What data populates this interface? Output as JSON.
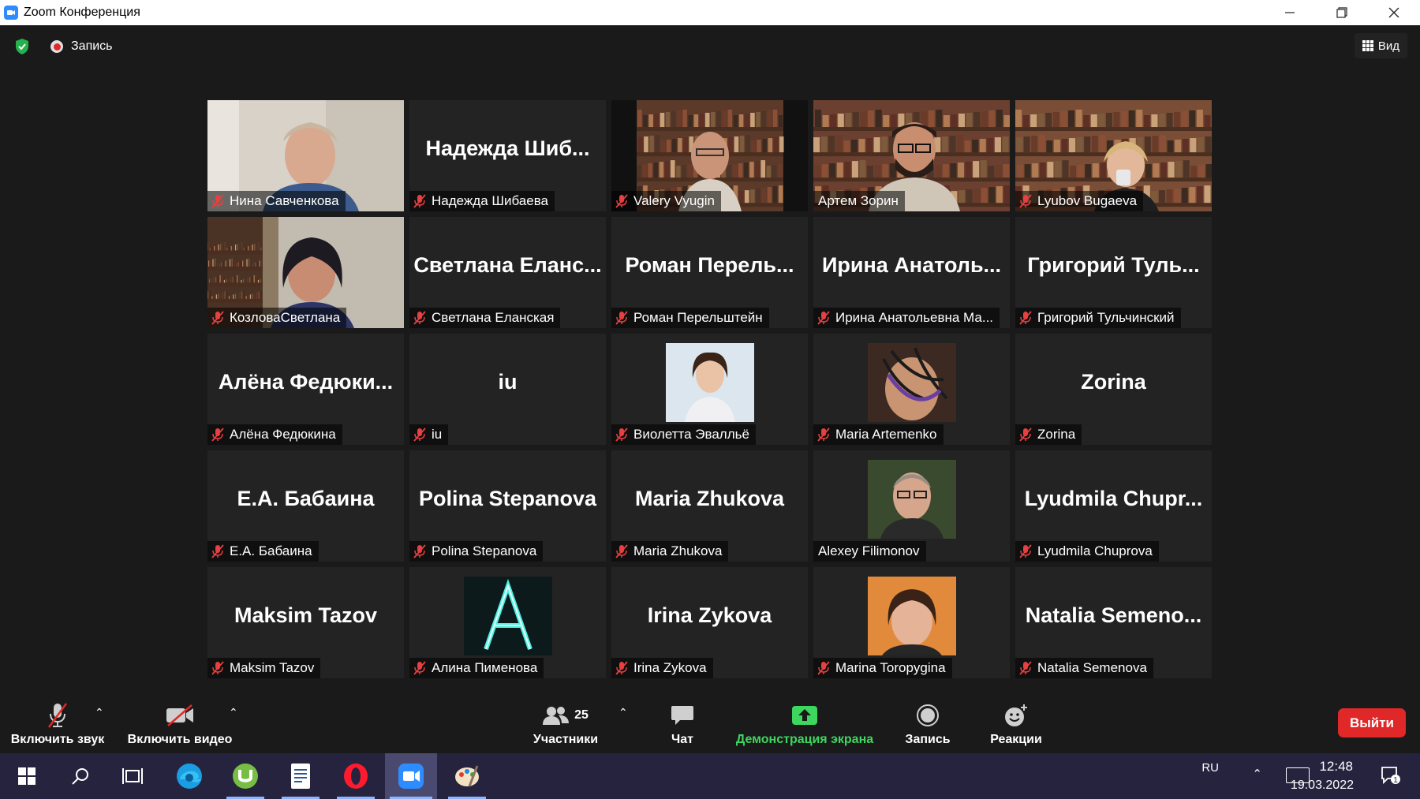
{
  "window": {
    "title": "Zoom Конференция"
  },
  "topbar": {
    "recording_label": "Запись",
    "view_label": "Вид"
  },
  "participants": [
    {
      "label": "Нина Савченкова",
      "big": "",
      "muted": true,
      "video": "nina"
    },
    {
      "label": "Надежда Шибаева",
      "big": "Надежда Шиб...",
      "muted": true,
      "video": ""
    },
    {
      "label": "Valery Vyugin",
      "big": "",
      "muted": true,
      "video": "valery"
    },
    {
      "label": "Артем Зорин",
      "big": "",
      "muted": false,
      "video": "artem",
      "active": true
    },
    {
      "label": "Lyubov Bugaeva",
      "big": "",
      "muted": true,
      "video": "lyubov"
    },
    {
      "label": "КозловаСветлана",
      "big": "",
      "muted": true,
      "video": "kozlova"
    },
    {
      "label": "Светлана Еланская",
      "big": "Светлана Еланс...",
      "muted": true,
      "video": ""
    },
    {
      "label": "Роман Перельштейн",
      "big": "Роман Перель...",
      "muted": true,
      "video": ""
    },
    {
      "label": "Ирина Анатольевна Ма...",
      "big": "Ирина Анатоль...",
      "muted": true,
      "video": ""
    },
    {
      "label": "Григорий Тульчинский",
      "big": "Григорий Туль...",
      "muted": true,
      "video": ""
    },
    {
      "label": "Алёна Федюкина",
      "big": "Алёна Федюки...",
      "muted": true,
      "video": ""
    },
    {
      "label": "iu",
      "big": "iu",
      "muted": true,
      "video": ""
    },
    {
      "label": "Виолетта Эвалльё",
      "big": "",
      "muted": true,
      "video": "photo-violetta"
    },
    {
      "label": "Maria Artemenko",
      "big": "",
      "muted": true,
      "video": "photo-maria"
    },
    {
      "label": "Zorina",
      "big": "Zorina",
      "muted": true,
      "video": ""
    },
    {
      "label": "Е.А. Бабаина",
      "big": "Е.А. Бабаина",
      "muted": true,
      "video": ""
    },
    {
      "label": "Polina Stepanova",
      "big": "Polina Stepanova",
      "muted": true,
      "video": ""
    },
    {
      "label": "Maria Zhukova",
      "big": "Maria Zhukova",
      "muted": true,
      "video": ""
    },
    {
      "label": "Alexey Filimonov",
      "big": "",
      "muted": false,
      "video": "photo-alexey"
    },
    {
      "label": "Lyudmila Chuprova",
      "big": "Lyudmila Chupr...",
      "muted": true,
      "video": ""
    },
    {
      "label": "Maksim Tazov",
      "big": "Maksim Tazov",
      "muted": true,
      "video": ""
    },
    {
      "label": "Алина Пименова",
      "big": "",
      "muted": true,
      "video": "photo-alina"
    },
    {
      "label": "Irina Zykova",
      "big": "Irina Zykova",
      "muted": true,
      "video": ""
    },
    {
      "label": "Marina Toropygina",
      "big": "",
      "muted": true,
      "video": "photo-marina"
    },
    {
      "label": "Natalia Semenova",
      "big": "Natalia Semeno...",
      "muted": true,
      "video": ""
    }
  ],
  "toolbar": {
    "unmute_label": "Включить звук",
    "video_label": "Включить видео",
    "participants_label": "Участники",
    "participants_count": "25",
    "chat_label": "Чат",
    "share_label": "Демонстрация экрана",
    "record_label": "Запись",
    "reactions_label": "Реакции",
    "leave_label": "Выйти",
    "share_color": "#3dd75f",
    "leave_color": "#e02828"
  },
  "taskbar": {
    "apps": [
      "windows-start-icon",
      "search-icon",
      "task-view-icon",
      "edge-icon",
      "utorrent-icon",
      "document-icon",
      "opera-icon",
      "zoom-icon",
      "paint-icon"
    ],
    "language": "RU",
    "time": "12:48",
    "date": "19.03.2022",
    "notification_count": "1"
  }
}
